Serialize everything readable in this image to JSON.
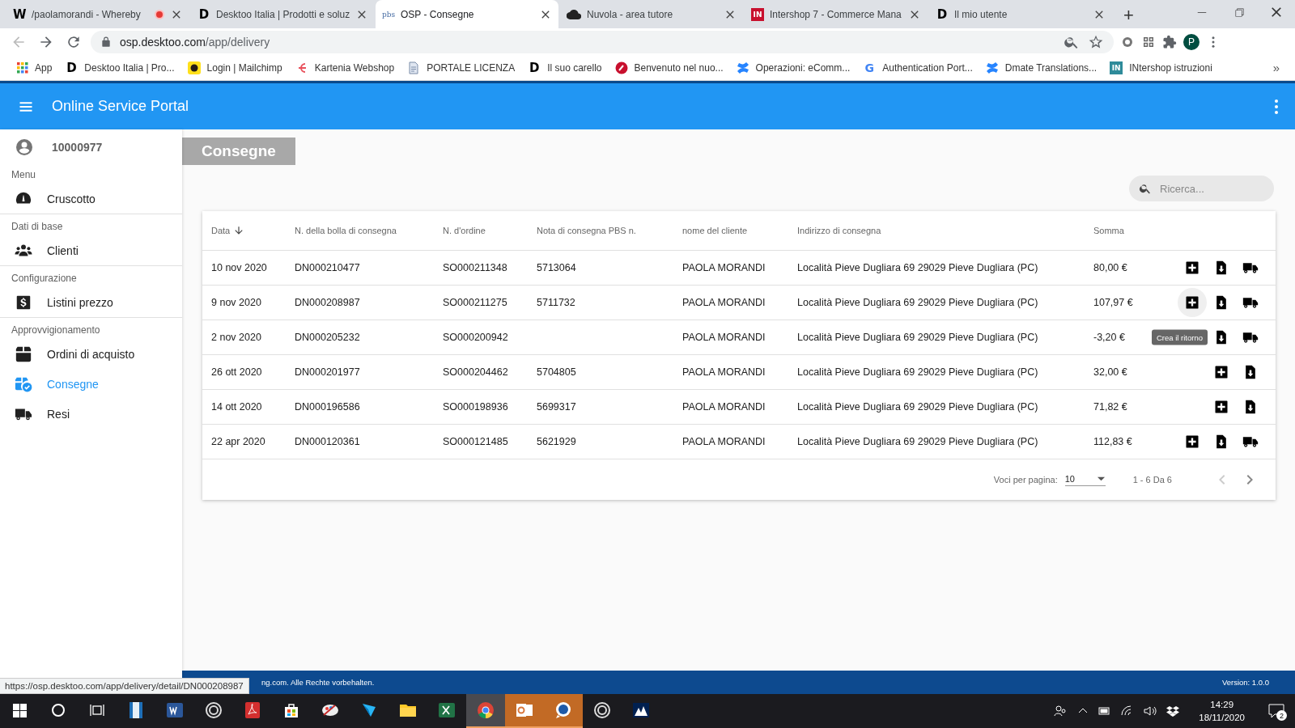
{
  "browser": {
    "tabs": [
      {
        "title": "/paolamorandi - Whereby",
        "logo": "W",
        "recording": true,
        "selected": false
      },
      {
        "title": "Desktoo Italia | Prodotti e soluz",
        "logo": "D",
        "recording": false,
        "selected": false
      },
      {
        "title": "OSP - Consegne",
        "logo": "pbs",
        "recording": false,
        "selected": true
      },
      {
        "title": "Nuvola - area tutore",
        "recording": false,
        "selected": false
      },
      {
        "title": "Intershop 7 - Commerce Mana",
        "logo": "IN",
        "recording": false,
        "selected": false
      },
      {
        "title": "Il mio utente",
        "logo": "D",
        "recording": false,
        "selected": false
      }
    ],
    "new_tab": "+",
    "address": {
      "host": "osp.desktoo.com",
      "path": "/app/delivery"
    },
    "profile": "P",
    "bookmarks": [
      {
        "label": "App"
      },
      {
        "label": "Desktoo Italia | Pro...",
        "logo": "D"
      },
      {
        "label": "Login | Mailchimp"
      },
      {
        "label": "Kartenia Webshop"
      },
      {
        "label": "PORTALE LICENZA"
      },
      {
        "label": "Il suo carello",
        "logo": "D"
      },
      {
        "label": "Benvenuto nel nuo..."
      },
      {
        "label": "Operazioni: eComm..."
      },
      {
        "label": "Authentication Port...",
        "logo": "G"
      },
      {
        "label": "Dmate Translations..."
      },
      {
        "label": "INtershop istruzioni",
        "logo": "IN"
      }
    ],
    "bookmarks_more": "»"
  },
  "app": {
    "title": "Online Service Portal",
    "user": "10000977",
    "nav": [
      {
        "kind": "section",
        "label": "Menu"
      },
      {
        "kind": "item",
        "label": "Cruscotto",
        "selected": false
      },
      {
        "kind": "section",
        "label": "Dati di base"
      },
      {
        "kind": "item",
        "label": "Clienti",
        "selected": false
      },
      {
        "kind": "section",
        "label": "Configurazione"
      },
      {
        "kind": "item",
        "label": "Listini prezzo",
        "selected": false
      },
      {
        "kind": "section",
        "label": "Approvvigionamento"
      },
      {
        "kind": "item",
        "label": "Ordini di acquisto",
        "selected": false
      },
      {
        "kind": "item",
        "label": "Consegne",
        "selected": true
      },
      {
        "kind": "item",
        "label": "Resi",
        "selected": false
      }
    ]
  },
  "page": {
    "heading": "Consegne",
    "search": {
      "placeholder": "Ricerca..."
    },
    "table": {
      "columns": [
        {
          "label": "Data",
          "sorted": true
        },
        {
          "label": "N. della bolla di consegna",
          "sorted": false
        },
        {
          "label": "N. d'ordine",
          "sorted": false
        },
        {
          "label": "Nota di consegna PBS n.",
          "sorted": false
        },
        {
          "label": "nome del cliente",
          "sorted": false
        },
        {
          "label": "Indirizzo di consegna",
          "sorted": false
        },
        {
          "label": "Somma",
          "sorted": false
        }
      ],
      "rows": [
        {
          "cells": [
            "10 nov 2020",
            "DN000210477",
            "SO000211348",
            "5713064",
            "PAOLA MORANDI",
            "Località Pieve Dugliara 69 29029 Pieve Dugliara (PC)",
            "80,00 €"
          ],
          "actions": [
            {
              "kind": "add",
              "hovered": false
            },
            {
              "kind": "download",
              "hovered": false
            },
            {
              "kind": "truck",
              "hovered": false
            }
          ]
        },
        {
          "cells": [
            "9 nov 2020",
            "DN000208987",
            "SO000211275",
            "5711732",
            "PAOLA MORANDI",
            "Località Pieve Dugliara 69 29029 Pieve Dugliara (PC)",
            "107,97 €"
          ],
          "actions": [
            {
              "kind": "add",
              "hovered": true
            },
            {
              "kind": "download",
              "hovered": false
            },
            {
              "kind": "truck",
              "hovered": false
            }
          ]
        },
        {
          "cells": [
            "2 nov 2020",
            "DN000205232",
            "SO000200942",
            "",
            "PAOLA MORANDI",
            "Località Pieve Dugliara 69 29029 Pieve Dugliara (PC)",
            "-3,20 €"
          ],
          "actions": [
            {
              "kind": "download",
              "hovered": false
            },
            {
              "kind": "truck",
              "hovered": false
            }
          ],
          "tooltip": "Crea il ritorno"
        },
        {
          "cells": [
            "26 ott 2020",
            "DN000201977",
            "SO000204462",
            "5704805",
            "PAOLA MORANDI",
            "Località Pieve Dugliara 69 29029 Pieve Dugliara (PC)",
            "32,00 €"
          ],
          "actions": [
            {
              "kind": "add",
              "hovered": false
            },
            {
              "kind": "download",
              "hovered": false
            }
          ]
        },
        {
          "cells": [
            "14 ott 2020",
            "DN000196586",
            "SO000198936",
            "5699317",
            "PAOLA MORANDI",
            "Località Pieve Dugliara 69 29029 Pieve Dugliara (PC)",
            "71,82 €"
          ],
          "actions": [
            {
              "kind": "add",
              "hovered": false
            },
            {
              "kind": "download",
              "hovered": false
            }
          ]
        },
        {
          "cells": [
            "22 apr 2020",
            "DN000120361",
            "SO000121485",
            "5621929",
            "PAOLA MORANDI",
            "Località Pieve Dugliara 69 29029 Pieve Dugliara (PC)",
            "112,83 €"
          ],
          "actions": [
            {
              "kind": "add",
              "hovered": false
            },
            {
              "kind": "download",
              "hovered": false
            },
            {
              "kind": "truck",
              "hovered": false
            }
          ]
        }
      ]
    },
    "pagination": {
      "label": "Voci per pagina:",
      "page_size": "10",
      "range": "1 - 6 Da 6",
      "prev_disabled": true,
      "next_disabled": false
    }
  },
  "footer": {
    "copyright": "ng.com. Alle Rechte vorbehalten.",
    "version": "Version: 1.0.0"
  },
  "status_url": "https://osp.desktoo.com/app/delivery/detail/DN000208987",
  "taskbar": {
    "apps": [
      {
        "active": false
      },
      {
        "active": false
      },
      {
        "active": false
      },
      {
        "active": false
      },
      {
        "active": false
      },
      {
        "active": false
      },
      {
        "active": false
      },
      {
        "active": false
      },
      {
        "active": false
      },
      {
        "active": true
      },
      {
        "active": true
      },
      {
        "active": true
      },
      {
        "active": false
      },
      {
        "active": false
      }
    ],
    "time": "14:29",
    "date": "18/11/2020",
    "notifications": "2"
  }
}
